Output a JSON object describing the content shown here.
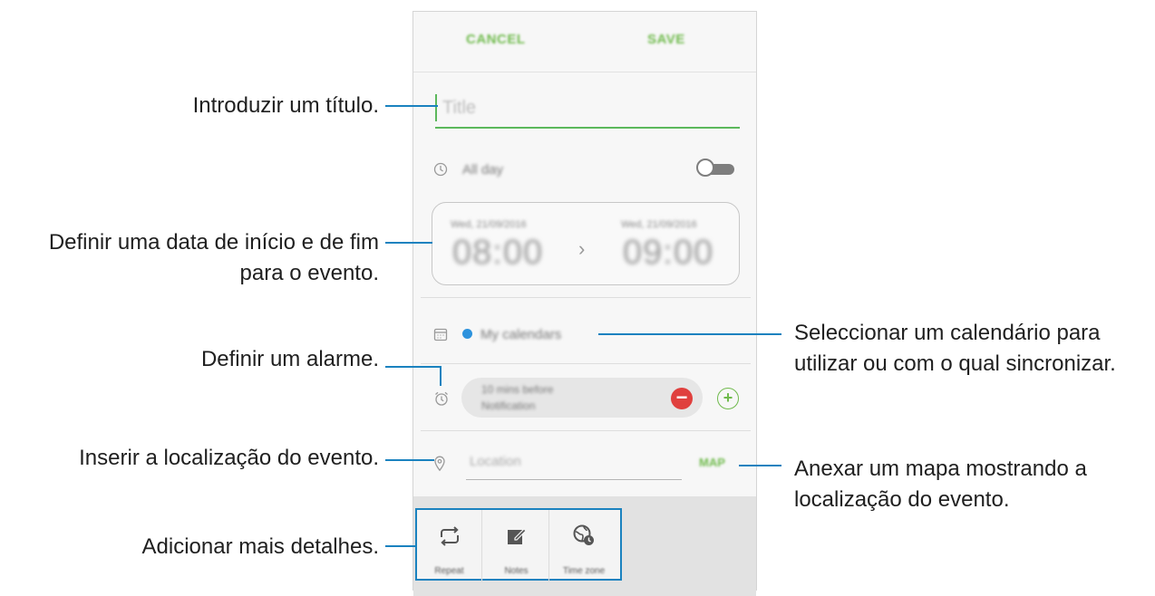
{
  "screen": {
    "topbar": {
      "cancel_label": "CANCEL",
      "save_label": "SAVE"
    },
    "title_field": {
      "placeholder": "Title"
    },
    "all_day": {
      "label": "All day",
      "enabled": false
    },
    "date_range": {
      "start_date": "Wed, 21/09/2016",
      "start_time": "08:00",
      "end_date": "Wed, 21/09/2016",
      "end_time": "09:00"
    },
    "calendar": {
      "label": "My calendars",
      "color": "#2e93dd"
    },
    "reminder": {
      "line1": "10 mins before",
      "line2": "Notification"
    },
    "location": {
      "placeholder": "Location",
      "map_label": "MAP"
    },
    "details_bar": {
      "items": [
        {
          "label": "Repeat",
          "icon": "repeat-icon"
        },
        {
          "label": "Notes",
          "icon": "notes-icon"
        },
        {
          "label": "Time zone",
          "icon": "time-zone-icon"
        }
      ]
    }
  },
  "callouts": {
    "title": "Introduzir um título.",
    "dates_line1": "Definir uma data de início e de fim",
    "dates_line2": "para o evento.",
    "calendar_line1": "Seleccionar um calendário para",
    "calendar_line2": "utilizar ou com o qual sincronizar.",
    "alarm": "Definir um alarme.",
    "location": "Inserir a localização do evento.",
    "map_line1": "Anexar um mapa mostrando a",
    "map_line2": "localização do evento.",
    "details": "Adicionar mais detalhes."
  },
  "colors": {
    "accent": "#6fba4c",
    "callout_line": "#1a82bf",
    "delete": "#e0403e"
  }
}
